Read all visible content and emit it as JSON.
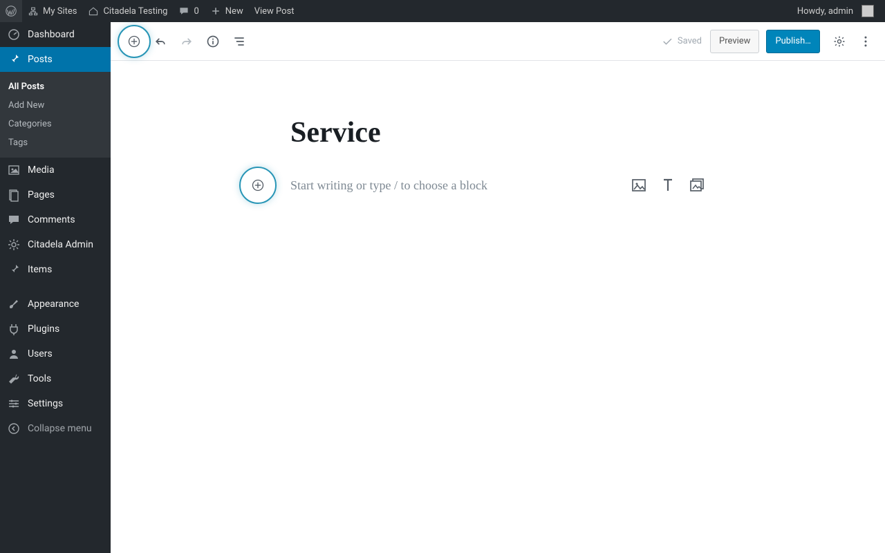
{
  "adminbar": {
    "my_sites": "My Sites",
    "site_name": "Citadela Testing",
    "comments_count": "0",
    "new_label": "New",
    "view_post": "View Post",
    "howdy": "Howdy, admin"
  },
  "sidebar": {
    "dashboard": "Dashboard",
    "posts": "Posts",
    "posts_sub": {
      "all": "All Posts",
      "add": "Add New",
      "categories": "Categories",
      "tags": "Tags"
    },
    "media": "Media",
    "pages": "Pages",
    "comments": "Comments",
    "citadela_admin": "Citadela Admin",
    "items": "Items",
    "appearance": "Appearance",
    "plugins": "Plugins",
    "users": "Users",
    "tools": "Tools",
    "settings": "Settings",
    "collapse": "Collapse menu"
  },
  "editor": {
    "saved": "Saved",
    "preview": "Preview",
    "publish": "Publish…",
    "title": "Service",
    "placeholder": "Start writing or type / to choose a block"
  }
}
